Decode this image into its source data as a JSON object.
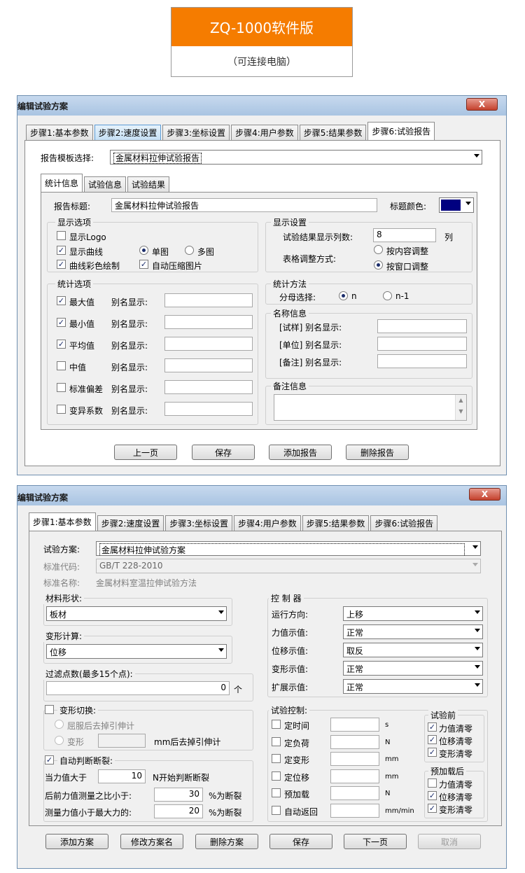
{
  "banner": {
    "title": "ZQ-1000软件版",
    "subtitle": "（可连接电脑）"
  },
  "window1": {
    "title": "编辑试验方案",
    "close": "X",
    "tabs": [
      "步骤1:基本参数",
      "步骤2:速度设置",
      "步骤3:坐标设置",
      "步骤4:用户参数",
      "步骤5:结果参数",
      "步骤6:试验报告"
    ],
    "template_label": "报告模板选择:",
    "template_value": "金属材料拉伸试验报告",
    "subtabs": [
      "统计信息",
      "试验信息",
      "试验结果"
    ],
    "report_title_label": "报告标题:",
    "report_title_value": "金属材料拉伸试验报告",
    "title_color_label": "标题颜色:",
    "title_color": "#000080",
    "display_options": {
      "title": "显示选项",
      "show_logo": "显示Logo",
      "show_curve": "显示曲线",
      "single": "单图",
      "multi": "多图",
      "color_curve": "曲线彩色绘制",
      "auto_compress": "自动压缩图片"
    },
    "display_settings": {
      "title": "显示设置",
      "cols_label": "试验结果显示列数:",
      "cols_value": "8",
      "cols_unit": "列",
      "adjust_label": "表格调整方式:",
      "by_content": "按内容调整",
      "by_window": "按窗口调整"
    },
    "stat_options": {
      "title": "统计选项",
      "alias": "别名显示:",
      "items": [
        "最大值",
        "最小值",
        "平均值",
        "中值",
        "标准偏差",
        "变异系数"
      ],
      "checked": [
        true,
        true,
        true,
        false,
        false,
        false
      ]
    },
    "stat_method": {
      "title": "统计方法",
      "denom_label": "分母选择:",
      "n": "n",
      "n1": "n-1"
    },
    "name_info": {
      "title": "名称信息",
      "items": [
        "[试样] 别名显示:",
        "[单位] 别名显示:",
        "[备注] 别名显示:"
      ]
    },
    "remark_title": "备注信息",
    "buttons": [
      "上一页",
      "保存",
      "添加报告",
      "删除报告"
    ]
  },
  "window2": {
    "title": "编辑试验方案",
    "close": "X",
    "tabs": [
      "步骤1:基本参数",
      "步骤2:速度设置",
      "步骤3:坐标设置",
      "步骤4:用户参数",
      "步骤5:结果参数",
      "步骤6:试验报告"
    ],
    "scheme_label": "试验方案:",
    "scheme_value": "金属材料拉伸试验方案",
    "std_code_label": "标准代码:",
    "std_code_value": "GB/T 228-2010",
    "std_name_label": "标准名称:",
    "std_name_value": "金属材料室温拉伸试验方法",
    "material_title": "材料形状:",
    "material_value": "板材",
    "deform_title": "变形计算:",
    "deform_value": "位移",
    "filter_title": "过滤点数(最多15个点):",
    "filter_value": "0",
    "filter_unit": "个",
    "controller": {
      "title": "控 制 器",
      "rows": [
        {
          "label": "运行方向:",
          "value": "上移"
        },
        {
          "label": "力值示值:",
          "value": "正常"
        },
        {
          "label": "位移示值:",
          "value": "取反"
        },
        {
          "label": "变形示值:",
          "value": "正常"
        },
        {
          "label": "扩展示值:",
          "value": "正常"
        }
      ]
    },
    "deform_switch": {
      "title": "变形切换:",
      "opt1": "屈服后去掉引伸计",
      "opt2": "变形",
      "opt2_suffix": "mm后去掉引伸计"
    },
    "auto_break": {
      "title": "自动判断断裂:",
      "row1_label": "当力值大于",
      "row1_value": "10",
      "row1_suffix": "N开始判断断裂",
      "row2_label": "后前力值测量之比小于:",
      "row2_value": "30",
      "row2_suffix": "%为断裂",
      "row3_label": "测量力值小于最大力的:",
      "row3_value": "20",
      "row3_suffix": "%为断裂"
    },
    "test_control": {
      "title": "试验控制:",
      "items": [
        {
          "label": "定时间",
          "unit": "s"
        },
        {
          "label": "定负荷",
          "unit": "N"
        },
        {
          "label": "定变形",
          "unit": "mm"
        },
        {
          "label": "定位移",
          "unit": "mm"
        },
        {
          "label": "预加载",
          "unit": "N"
        },
        {
          "label": "自动返回",
          "unit": "mm/min"
        }
      ]
    },
    "before_test": {
      "title": "试验前",
      "items": [
        "力值清零",
        "位移清零",
        "变形清零"
      ]
    },
    "after_preload": {
      "title": "预加载后",
      "items": [
        "力值清零",
        "位移清零",
        "变形清零"
      ],
      "checked": [
        false,
        true,
        true
      ]
    },
    "buttons": [
      "添加方案",
      "修改方案名",
      "删除方案",
      "保存",
      "下一页",
      "取消"
    ]
  }
}
